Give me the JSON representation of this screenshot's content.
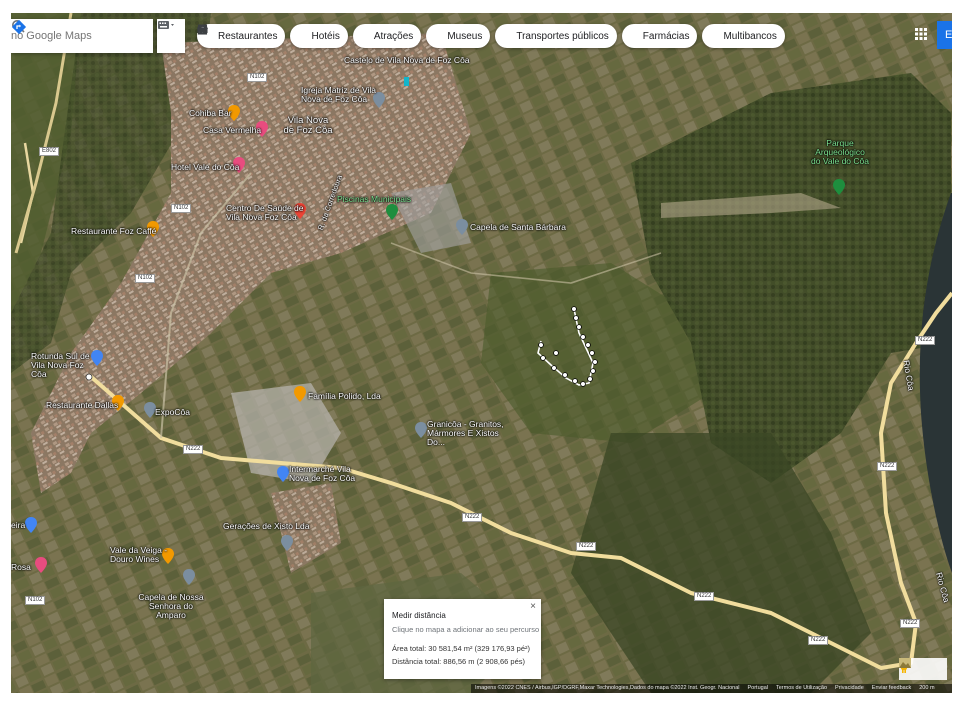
{
  "search": {
    "placeholder": "no Google Maps"
  },
  "categories": [
    {
      "icon": "restaurant-icon",
      "label": "Restaurantes"
    },
    {
      "icon": "hotel-icon",
      "label": "Hotéis"
    },
    {
      "icon": "attraction-icon",
      "label": "Atrações"
    },
    {
      "icon": "museum-icon",
      "label": "Museus"
    },
    {
      "icon": "transit-icon",
      "label": "Transportes públicos"
    },
    {
      "icon": "pharmacy-icon",
      "label": "Farmácias"
    },
    {
      "icon": "atm-icon",
      "label": "Multibancos"
    }
  ],
  "signin_label": "En",
  "places": {
    "castelo": "Castelo de Vila Nova de Foz Côa",
    "igreja": "Igreja Matriz de Vila Nova de Foz Côa",
    "cohiba": "Cohiba Bar",
    "casa_vermelha": "Casa Vermelha",
    "vila_nova": "Vila Nova de Foz Côa",
    "hotel": "Hotel Vale do Côa",
    "centro_saude": "Centro De Saúde de Vila Nova Foz Côa",
    "piscinas": "Piscinas Municipais",
    "capela_santa": "Capela de Santa Bárbara",
    "restaurante_foz": "Restaurante Foz Caffé",
    "parque": "Parque Arqueológico do Vale do Côa",
    "rotunda": "Rotunda Sul de Vila Nova Foz Côa",
    "dallas": "Restaurante Dallas",
    "expocoa": "ExpoCôa",
    "familia": "Família Polido, Lda",
    "granicoa": "Granicôa - Granitos, Mármores E Xistos Do...",
    "intermarche": "Intermarché Vila Nova de Foz Côa",
    "geracoes": "Gerações de Xisto Lda",
    "vale_veiga": "Vale da Veiga - Douro Wines",
    "capela_senhora": "Capela de Nossa Senhora do Amparo",
    "rosa": "Rosa",
    "eira": "eira",
    "rio_coa": "Rio Côa",
    "rua": "R. da Corredoura"
  },
  "roads": {
    "n102": "N102",
    "n222": "N222",
    "e802": "E802"
  },
  "measure": {
    "title": "Medir distância",
    "hint": "Clique no mapa a adicionar ao seu percurso",
    "area": "Área total: 30 581,54 m² (329 176,93 pé²)",
    "distance": "Distância total: 886,56 m (2 908,66 pés)"
  },
  "footer": {
    "imagery": "Imagens ©2022 CNES / Airbus,IGP/DGRF,Maxar Technologies,Dados do mapa ©2022 Inst. Geogr. Nacional",
    "lang": "Portugal",
    "terms": "Termos de Utilização",
    "privacy": "Privacidade",
    "feedback": "Enviar feedback",
    "scale": "200 m"
  }
}
